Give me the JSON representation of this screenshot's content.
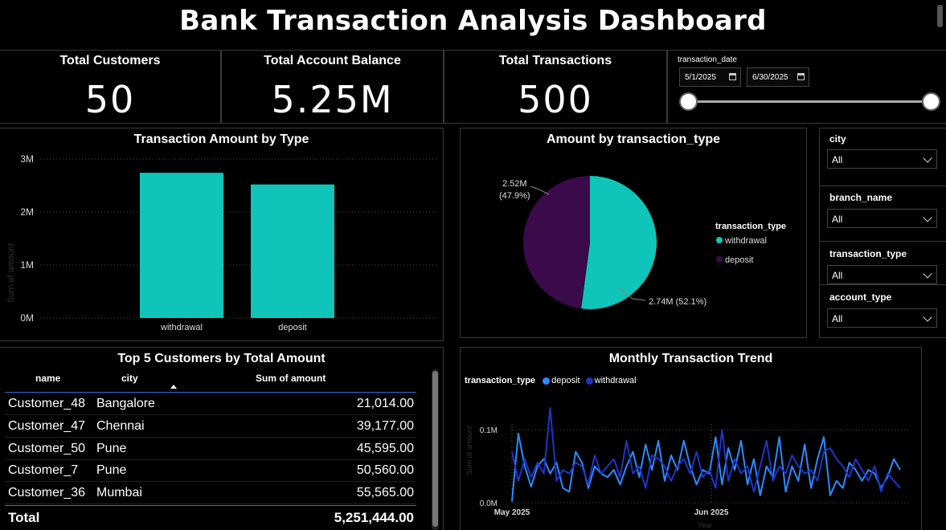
{
  "dashboard": {
    "title": "Bank Transaction Analysis Dashboard"
  },
  "kpis": [
    {
      "label": "Total Customers",
      "value": "50"
    },
    {
      "label": "Total Account Balance",
      "value": "5.25M"
    },
    {
      "label": "Total Transactions",
      "value": "500"
    }
  ],
  "date_slicer": {
    "label": "transaction_date",
    "start": "5/1/2025",
    "end": "6/30/2025",
    "icon": "calendar-icon",
    "range_fraction": [
      0.0,
      1.0
    ]
  },
  "slicers": [
    {
      "label": "city",
      "value": "All"
    },
    {
      "label": "branch_name",
      "value": "All"
    },
    {
      "label": "transaction_type",
      "value": "All"
    },
    {
      "label": "account_type",
      "value": "All"
    }
  ],
  "bar_chart": {
    "title": "Transaction Amount by Type",
    "ylabel": "Sum of amount",
    "ticks": [
      "3M",
      "2M",
      "1M",
      "0M"
    ],
    "color": "#0fc5b9"
  },
  "pie_chart": {
    "title": "Amount by transaction_type",
    "legend_title": "transaction_type",
    "label_deposit_value": "2.52M",
    "label_deposit_pct": "(47.9%)",
    "label_withdrawal": "2.74M (52.1%)"
  },
  "table": {
    "title": "Top 5 Customers by Total Amount",
    "columns": [
      "name",
      "city",
      "Sum of amount"
    ],
    "rows": [
      [
        "Customer_48",
        "Bangalore",
        "21,014.00"
      ],
      [
        "Customer_47",
        "Chennai",
        "39,177.00"
      ],
      [
        "Customer_50",
        "Pune",
        "45,595.00"
      ],
      [
        "Customer_7",
        "Pune",
        "50,560.00"
      ],
      [
        "Customer_36",
        "Mumbai",
        "55,565.00"
      ]
    ],
    "total_label": "Total",
    "total_value": "5,251,444.00",
    "sort_icon": "sort-ascending-icon"
  },
  "line_chart": {
    "title": "Monthly Transaction Trend",
    "legend_title": "transaction_type",
    "ylabel": "Sum of amount",
    "xlabel": "Year",
    "y_ticks": [
      "0.1M",
      "0.0M"
    ],
    "x_ticks": [
      "May 2025",
      "Jun 2025"
    ]
  },
  "chart_data": [
    {
      "type": "bar",
      "title": "Transaction Amount by Type",
      "categories": [
        "withdrawal",
        "deposit"
      ],
      "values": [
        2.74,
        2.52
      ],
      "unit": "M",
      "ylabel": "Sum of amount",
      "ylim": [
        0,
        3
      ],
      "grid": true
    },
    {
      "type": "pie",
      "title": "Amount by transaction_type",
      "categories": [
        "withdrawal",
        "deposit"
      ],
      "values": [
        2.74,
        2.52
      ],
      "percents": [
        52.1,
        47.9
      ],
      "colors": [
        "#0fc5b9",
        "#3a0a4a"
      ],
      "legend_position": "right"
    },
    {
      "type": "line",
      "title": "Monthly Transaction Trend",
      "ylabel": "Sum of amount",
      "xlabel": "Year",
      "ylim": [
        0,
        0.13
      ],
      "x_range": [
        "2025-05-01",
        "2025-06-30"
      ],
      "series": [
        {
          "name": "deposit",
          "color": "#2b8cff",
          "values": [
            0.002,
            0.095,
            0.05,
            0.022,
            0.05,
            0.06,
            0.04,
            0.055,
            0.02,
            0.015,
            0.07,
            0.055,
            0.02,
            0.05,
            0.04,
            0.035,
            0.045,
            0.025,
            0.05,
            0.07,
            0.035,
            0.08,
            0.045,
            0.085,
            0.03,
            0.065,
            0.045,
            0.085,
            0.05,
            0.025,
            0.045,
            0.04,
            0.09,
            0.025,
            0.075,
            0.045,
            0.085,
            0.025,
            0.06,
            0.01,
            0.05,
            0.035,
            0.09,
            0.015,
            0.05,
            0.03,
            0.08,
            0.02,
            0.06,
            0.09,
            0.01,
            0.03,
            0.02,
            0.055,
            0.045,
            0.03,
            0.045,
            0.04,
            0.02,
            0.035,
            0.06,
            0.045
          ]
        },
        {
          "name": "withdrawal",
          "color": "#1e35c8",
          "values": [
            0.07,
            0.03,
            0.06,
            0.035,
            0.055,
            0.04,
            0.14,
            0.03,
            0.045,
            0.04,
            0.055,
            0.05,
            0.025,
            0.065,
            0.04,
            0.05,
            0.06,
            0.035,
            0.085,
            0.04,
            0.05,
            0.02,
            0.065,
            0.06,
            0.05,
            0.03,
            0.05,
            0.06,
            0.04,
            0.07,
            0.035,
            0.045,
            0.02,
            0.1,
            0.03,
            0.06,
            0.04,
            0.05,
            0.015,
            0.05,
            0.085,
            0.03,
            0.05,
            0.04,
            0.065,
            0.05,
            0.04,
            0.045,
            0.03,
            0.07,
            0.075,
            0.06,
            0.05,
            0.035,
            0.06,
            0.045,
            0.03,
            0.05,
            0.015,
            0.04,
            0.03,
            0.02
          ]
        }
      ],
      "x_ticks": [
        "May 2025",
        "Jun 2025"
      ],
      "grid": true,
      "legend_position": "top-left"
    }
  ]
}
